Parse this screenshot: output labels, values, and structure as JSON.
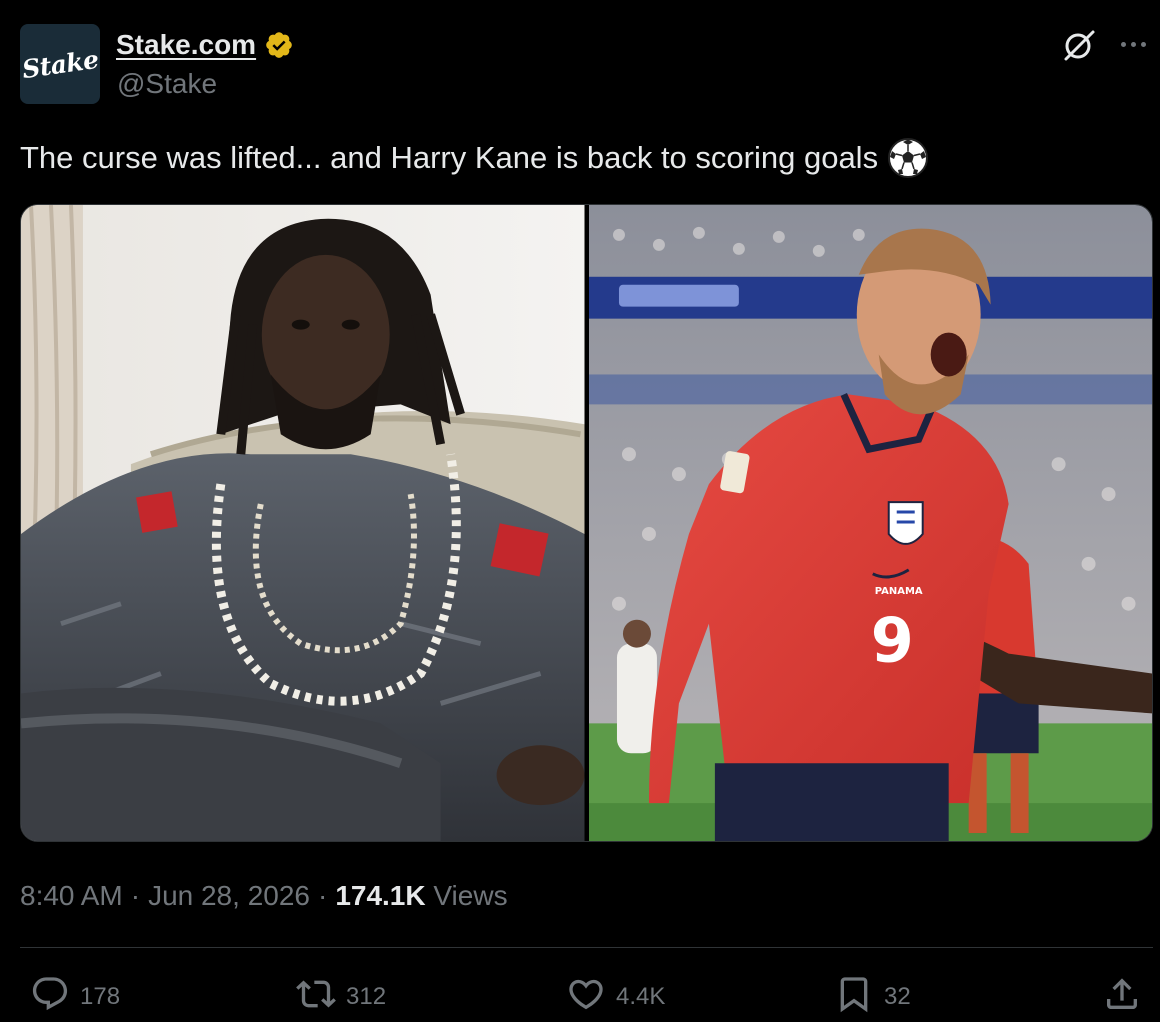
{
  "account": {
    "avatar_text": "Stake",
    "display_name": "Stake.com",
    "handle": "@Stake",
    "verified_badge_color": "#e2b719"
  },
  "tweet": {
    "text": "The curse was lifted... and Harry Kane is back to scoring goals",
    "emoji": "soccer-ball-icon"
  },
  "media": {
    "left_image": {
      "description_icon": "photo-man-with-dreadlocks"
    },
    "right_image": {
      "description_icon": "photo-footballer-celebrating",
      "jersey_number": "9",
      "jersey_text": "PANAMA"
    }
  },
  "meta": {
    "time": "8:40 AM",
    "separator": "·",
    "date": "Jun 28, 2026",
    "views_count": "174.1K",
    "views_label": "Views"
  },
  "actions": {
    "replies": "178",
    "reposts": "312",
    "likes": "4.4K",
    "bookmarks": "32"
  },
  "colors": {
    "background": "#000000",
    "text_primary": "#e7e9ea",
    "text_secondary": "#71767b",
    "border": "#2f3336"
  }
}
